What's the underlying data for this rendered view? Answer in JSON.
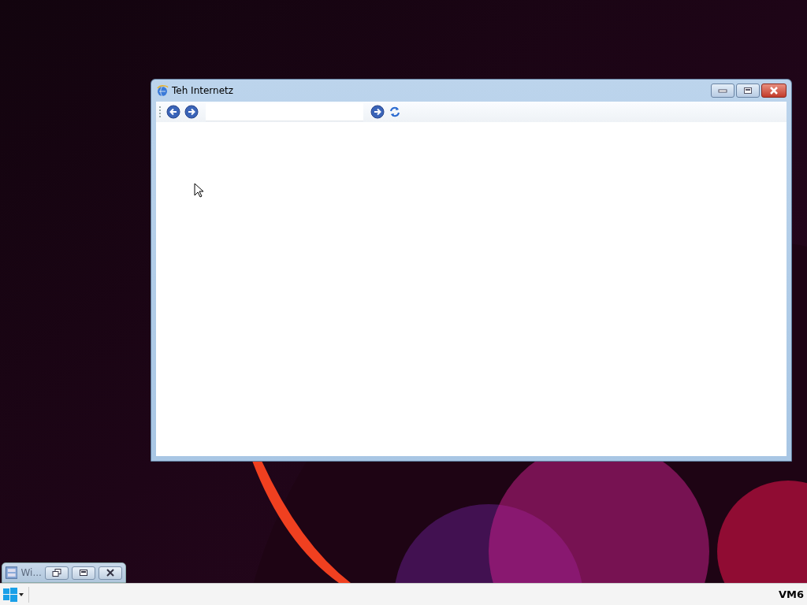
{
  "window": {
    "title": "Teh Internetz"
  },
  "minimized_window": {
    "title": "Wi..."
  },
  "taskbar": {
    "label": "VM6"
  }
}
